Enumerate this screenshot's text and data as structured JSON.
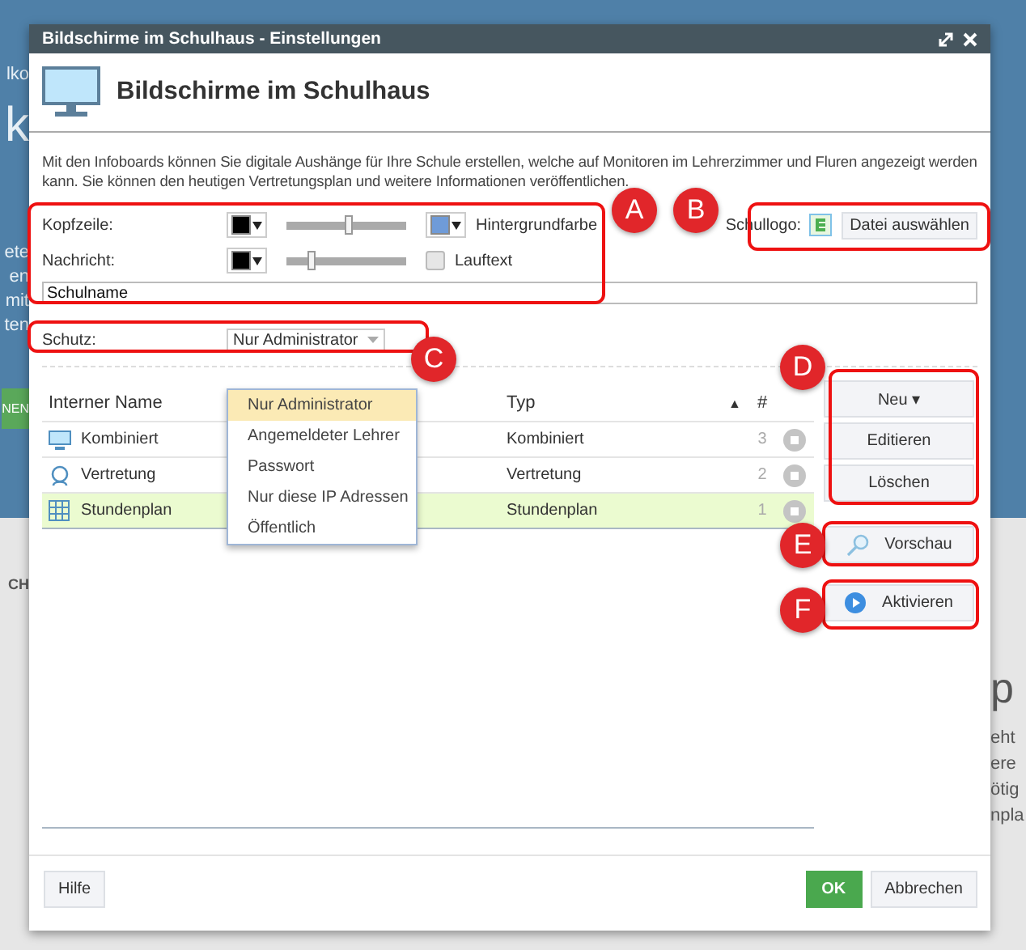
{
  "background": {
    "left": [
      {
        "text": "lko",
        "kind": "small"
      },
      {
        "text": "k",
        "kind": "big"
      },
      {
        "text": "ete",
        "kind": "small"
      },
      {
        "text": "en",
        "kind": "small"
      },
      {
        "text": "mit",
        "kind": "small"
      },
      {
        "text": "ten",
        "kind": "small"
      },
      {
        "text": "NEN",
        "kind": "button"
      },
      {
        "text": "CH",
        "kind": "dark"
      }
    ],
    "right": [
      {
        "text": "p",
        "kind": "bigdark"
      },
      {
        "text": "eht",
        "kind": "dark"
      },
      {
        "text": "ere",
        "kind": "dark"
      },
      {
        "text": "ötig",
        "kind": "dark"
      },
      {
        "text": "npla",
        "kind": "dark"
      }
    ]
  },
  "window": {
    "title": "Bildschirme im Schulhaus - Einstellungen"
  },
  "header": {
    "title": "Bildschirme im Schulhaus"
  },
  "description": "Mit den Infoboards können Sie digitale Aushänge für Ihre Schule erstellen, welche auf Monitoren im Lehrerzimmer und Fluren angezeigt werden kann. Sie können den heutigen Vertretungsplan und weitere Informationen veröffentlichen.",
  "kopfzeile": {
    "label": "Kopfzeile:",
    "color": "#000000",
    "level": 0.51,
    "background": {
      "label": "Hintergrundfarbe",
      "color": "#6f9bd8"
    }
  },
  "nachricht": {
    "label": "Nachricht:",
    "color": "#000000",
    "level": 0.2,
    "checkbox": {
      "label": "Lauftext",
      "checked": false
    }
  },
  "schullogo": {
    "label": "Schullogo:",
    "button": "Datei auswählen"
  },
  "text_field": {
    "value": "Schulname"
  },
  "schutz": {
    "label": "Schutz:",
    "value": "Nur Administrator",
    "options": [
      {
        "label": "Nur Administrator",
        "selected": true
      },
      {
        "label": "Angemeldeter Lehrer",
        "selected": false
      },
      {
        "label": "Passwort",
        "selected": false
      },
      {
        "label": "Nur diese IP Adressen",
        "selected": false
      },
      {
        "label": "Öffentlich",
        "selected": false
      }
    ]
  },
  "table": {
    "columns": [
      "Interner Name",
      "Typ",
      "▲",
      "#"
    ],
    "rows": [
      {
        "kind": "monitor",
        "name": "Kombiniert",
        "type": "Kombiniert",
        "number": "3",
        "selected": false
      },
      {
        "kind": "person",
        "name": "Vertretung",
        "type": "Vertretung",
        "number": "2",
        "selected": false
      },
      {
        "kind": "grid",
        "name": "Stundenplan",
        "type": "Stundenplan",
        "number": "1",
        "selected": true
      }
    ]
  },
  "side_buttons": [
    {
      "label": "Neu ▾",
      "kind": "plain"
    },
    {
      "label": "Editieren",
      "kind": "plain"
    },
    {
      "label": "Löschen",
      "kind": "plain"
    },
    {
      "label": "Vorschau",
      "kind": "search"
    },
    {
      "label": "Aktivieren",
      "kind": "play"
    }
  ],
  "footer": {
    "help": "Hilfe",
    "ok": "OK",
    "cancel": "Abbrechen"
  },
  "annotations": [
    "A",
    "B",
    "C",
    "D",
    "E",
    "F"
  ]
}
